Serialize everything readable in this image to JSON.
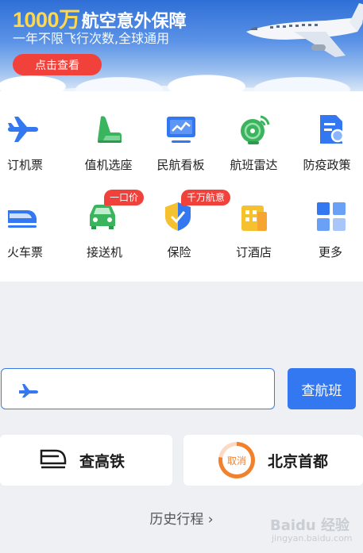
{
  "banner": {
    "title_big": "1000万",
    "title_rest": "航空意外保障",
    "subtitle": "一年不限飞行次数,全球通用",
    "button": "点击查看"
  },
  "services": [
    {
      "label": "订机票",
      "icon": "airplane-icon"
    },
    {
      "label": "值机选座",
      "icon": "seat-icon"
    },
    {
      "label": "民航看板",
      "icon": "dashboard-icon"
    },
    {
      "label": "航班雷达",
      "icon": "radar-icon"
    },
    {
      "label": "防疫政策",
      "icon": "policy-doc-icon"
    },
    {
      "label": "火车票",
      "icon": "train-icon"
    },
    {
      "label": "接送机",
      "icon": "car-icon"
    },
    {
      "label": "保险",
      "icon": "shield-icon"
    },
    {
      "label": "订酒店",
      "icon": "hotel-icon"
    },
    {
      "label": "更多",
      "icon": "grid-more-icon"
    }
  ],
  "badges": {
    "car": "一口价",
    "insurance": "千万航意"
  },
  "search": {
    "button": "查航班"
  },
  "cards": {
    "train": "查高铁",
    "flight": "北京首都",
    "flight_status": "取消"
  },
  "history": "历史行程 ›",
  "watermark": "Baidu 经验",
  "watermark_sub": "jingyan.baidu.com",
  "colors": {
    "accent": "#3378f0",
    "red": "#f0413b",
    "orange": "#f2812e"
  }
}
